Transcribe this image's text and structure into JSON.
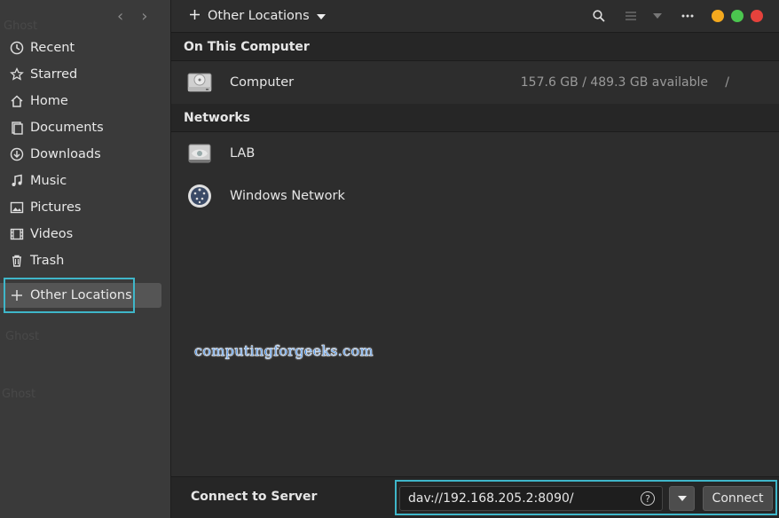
{
  "sidebar": {
    "items": [
      {
        "label": "Recent",
        "icon": "clock-icon"
      },
      {
        "label": "Starred",
        "icon": "star-icon"
      },
      {
        "label": "Home",
        "icon": "home-icon"
      },
      {
        "label": "Documents",
        "icon": "documents-icon"
      },
      {
        "label": "Downloads",
        "icon": "download-icon"
      },
      {
        "label": "Music",
        "icon": "music-icon"
      },
      {
        "label": "Pictures",
        "icon": "pictures-icon"
      },
      {
        "label": "Videos",
        "icon": "videos-icon"
      },
      {
        "label": "Trash",
        "icon": "trash-icon"
      },
      {
        "label": "Other Locations",
        "icon": "plus-icon",
        "active": true
      }
    ]
  },
  "header": {
    "path_label": "Other Locations"
  },
  "sections": {
    "computer": {
      "title": "On This Computer",
      "items": [
        {
          "name": "Computer",
          "usage": "157.6 GB / 489.3 GB available",
          "mount": "/"
        }
      ]
    },
    "networks": {
      "title": "Networks",
      "items": [
        {
          "name": "LAB"
        },
        {
          "name": "Windows Network"
        }
      ]
    }
  },
  "watermark": "computingforgeeks.com",
  "footer": {
    "label": "Connect to Server",
    "server_value": "dav://192.168.205.2:8090/",
    "connect_label": "Connect"
  },
  "colors": {
    "highlight": "#3fb6c9",
    "win_minimize": "#f4a91e",
    "win_maximize": "#4bc64f",
    "win_close": "#e5423c"
  }
}
